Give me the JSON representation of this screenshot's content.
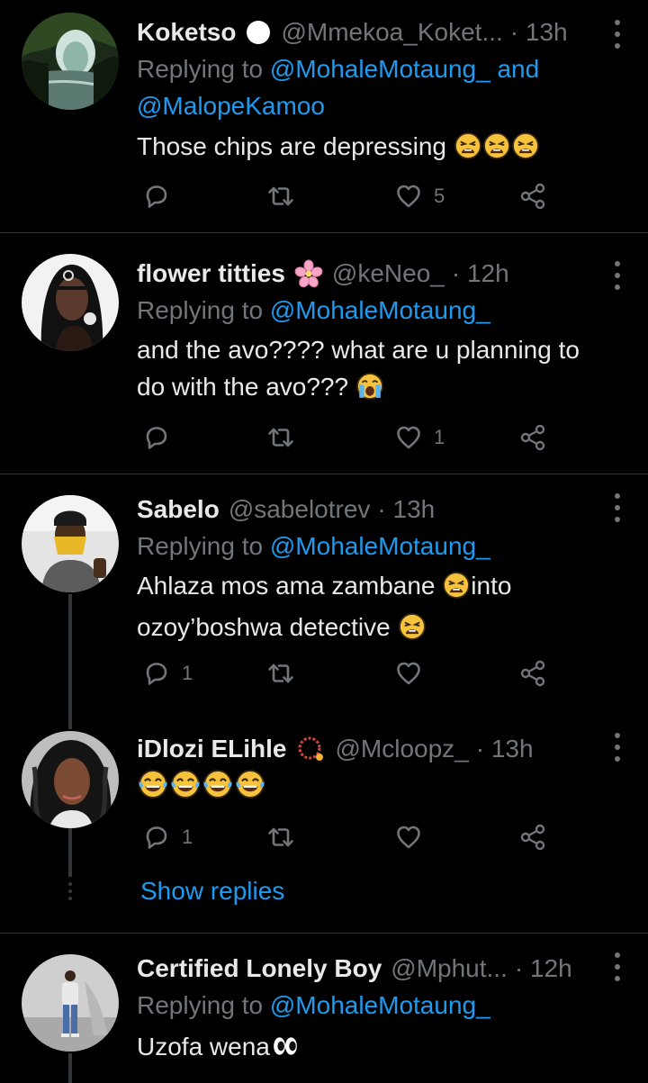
{
  "tweets": [
    {
      "name": "Koketso",
      "name_icon": "white-circle-icon",
      "handle": "@Mmekoa_Koket...",
      "time": "· 13h",
      "replying_prefix": "Replying to",
      "replying_mention1": "@MohaleMotaung_",
      "replying_and": "and",
      "replying_mention2": "@MalopeKamoo",
      "text": "Those chips are depressing",
      "emojis": [
        "weary-face-icon",
        "weary-face-icon",
        "weary-face-icon"
      ],
      "reply_count": "",
      "like_count": "5"
    },
    {
      "name": "flower titties",
      "name_icon": "cherry-blossom-icon",
      "handle": "@keNeo_",
      "time": "· 12h",
      "replying_prefix": "Replying to",
      "replying_mention1": "@MohaleMotaung_",
      "text_line1": "and the avo???? what are u planning to",
      "text_line2": "do with the avo???",
      "emojis": [
        "loudly-crying-face-icon"
      ],
      "reply_count": "",
      "like_count": "1"
    },
    {
      "name": "Sabelo",
      "handle": "@sabelotrev",
      "time": "· 13h",
      "replying_prefix": "Replying to",
      "replying_mention1": "@MohaleMotaung_",
      "text_line1a": "Ahlaza mos ama zambane ",
      "text_line1b": "into",
      "text_line2": "ozoy’boshwa detective ",
      "emojis": [
        "weary-face-icon",
        "weary-face-icon"
      ],
      "reply_count": "1",
      "like_count": ""
    },
    {
      "name": "iDlozi ELihle",
      "name_icon": "prayer-beads-icon",
      "handle": "@Mcloopz_",
      "time": "· 13h",
      "emojis": [
        "tears-of-joy-icon",
        "tears-of-joy-icon",
        "tears-of-joy-icon",
        "tears-of-joy-icon"
      ],
      "reply_count": "1",
      "like_count": "",
      "show_replies": "Show replies"
    },
    {
      "name": "Certified Lonely Boy",
      "handle": "@Mphut...",
      "time": "· 12h",
      "replying_prefix": "Replying to",
      "replying_mention1": "@MohaleMotaung_",
      "text": "Uzofa wena",
      "emojis": [
        "eyes-icon"
      ]
    }
  ],
  "colors": {
    "background": "#000000",
    "text": "#e7e9ea",
    "secondary": "#71767b",
    "accent": "#1d9bf0",
    "divider": "#2f3336"
  }
}
